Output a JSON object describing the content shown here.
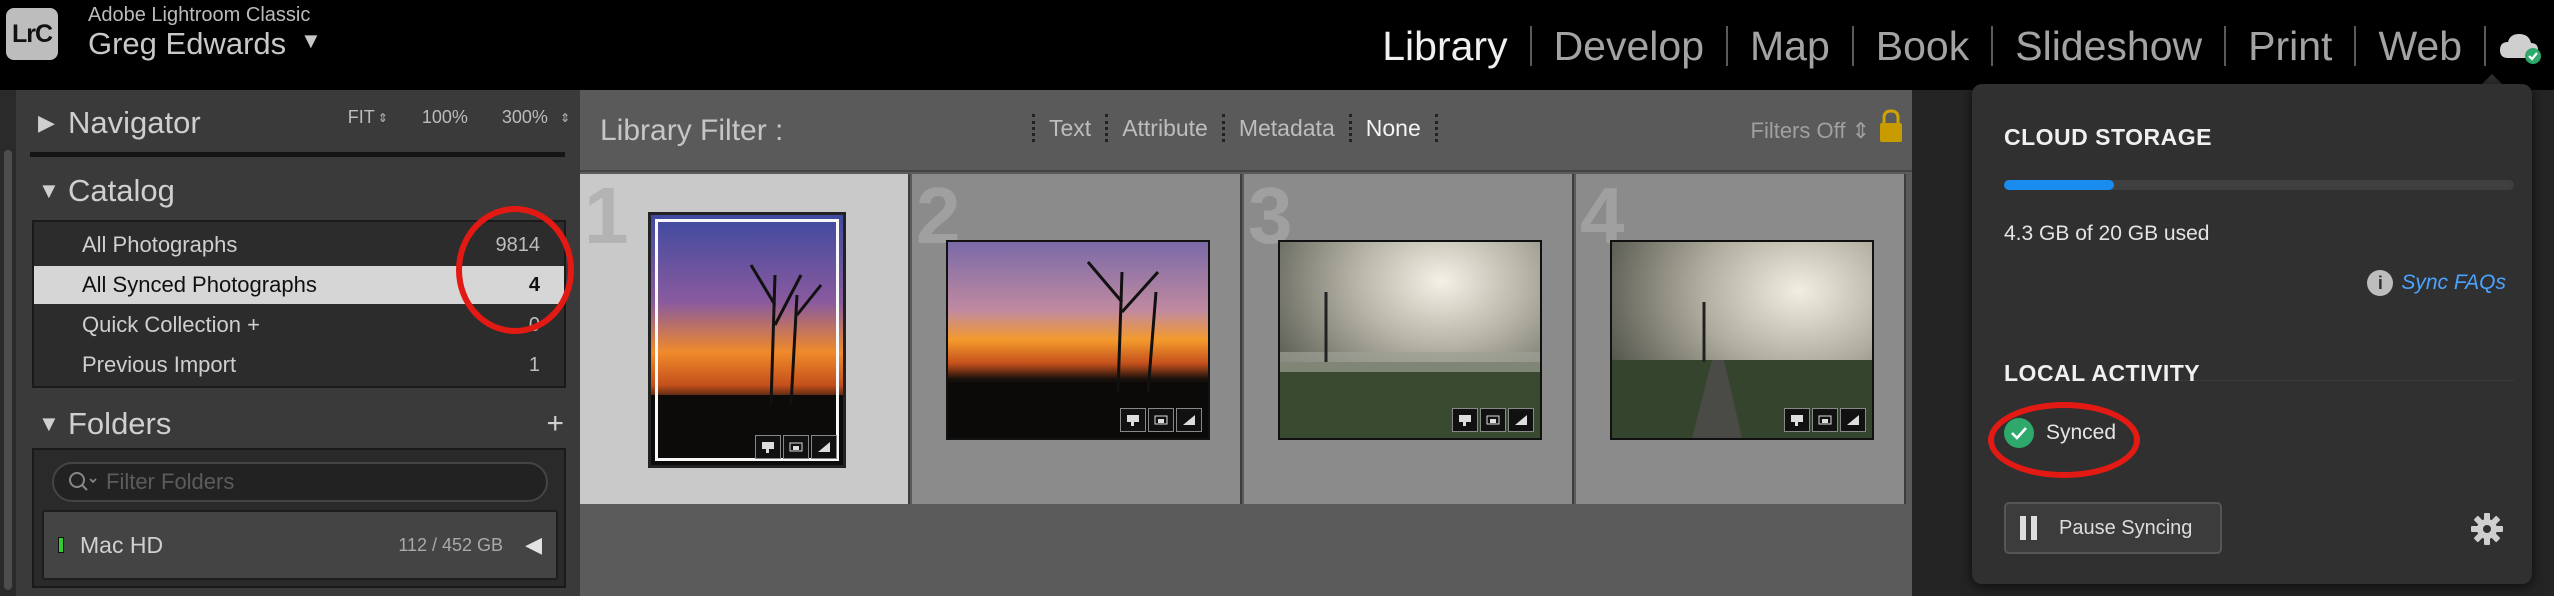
{
  "topbar": {
    "logo_text": "LrC",
    "app_name": "Adobe Lightroom Classic",
    "user_name": "Greg Edwards",
    "modules": [
      "Library",
      "Develop",
      "Map",
      "Book",
      "Slideshow",
      "Print",
      "Web"
    ],
    "active_module": "Library",
    "cloud_icon": "cloud-synced-icon"
  },
  "navigator": {
    "title": "Navigator",
    "options": [
      "FIT",
      "100%",
      "300%"
    ]
  },
  "catalog": {
    "title": "Catalog",
    "rows": [
      {
        "label": "All Photographs",
        "count": "9814"
      },
      {
        "label": "All Synced Photographs",
        "count": "4"
      },
      {
        "label": "Quick Collection +",
        "count": "0"
      },
      {
        "label": "Previous Import",
        "count": "1"
      }
    ],
    "selected_index": 1
  },
  "folders": {
    "title": "Folders",
    "add_symbol": "+",
    "search_placeholder": "Filter Folders",
    "volume": {
      "name": "Mac HD",
      "usage": "112 / 452 GB"
    }
  },
  "library_filter": {
    "title": "Library Filter :",
    "options": [
      "Text",
      "Attribute",
      "Metadata",
      "None"
    ],
    "active_option": "None",
    "filters_state": "Filters Off"
  },
  "grid": {
    "cells": [
      {
        "number": "1",
        "scene": "sunset",
        "selected": true
      },
      {
        "number": "2",
        "scene": "sunset",
        "selected": false
      },
      {
        "number": "3",
        "scene": "mist",
        "selected": false
      },
      {
        "number": "4",
        "scene": "mist",
        "selected": false
      }
    ]
  },
  "cloud_popup": {
    "storage_heading": "CLOUD STORAGE",
    "storage_used_fraction": 0.215,
    "storage_text": "4.3 GB of 20 GB used",
    "sync_faqs": "Sync FAQs",
    "activity_heading": "LOCAL ACTIVITY",
    "status": "Synced",
    "pause_label": "Pause Syncing",
    "accent_color": "#1a8cf0",
    "synced_color": "#2ea86b"
  },
  "annotation_color": "#e31a13"
}
